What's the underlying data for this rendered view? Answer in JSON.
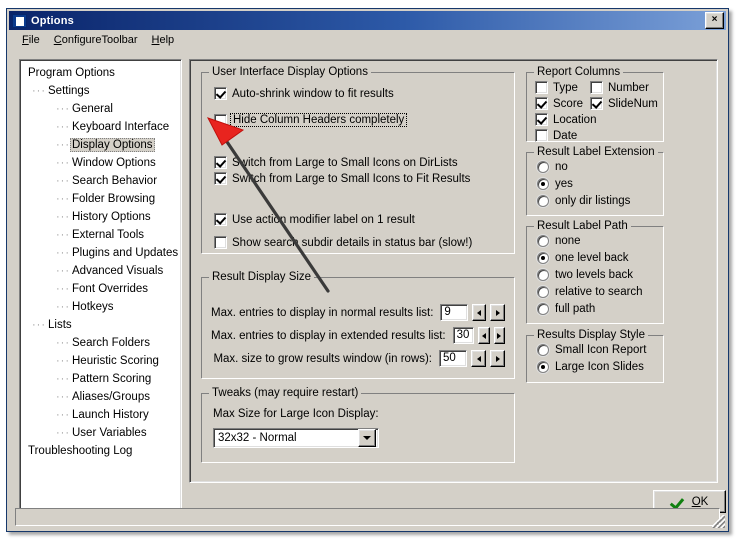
{
  "window": {
    "title": "Options",
    "icon": "options-list-icon",
    "close_label": "×"
  },
  "menu": {
    "items": [
      {
        "accel": "F",
        "rest": "ile"
      },
      {
        "accel": "C",
        "rest": "onfigureToolbar"
      },
      {
        "accel": "H",
        "rest": "elp"
      }
    ]
  },
  "tree": {
    "nodes": [
      {
        "label": "Program Options",
        "level": 0,
        "selected": false
      },
      {
        "label": "Settings",
        "level": 1,
        "selected": false
      },
      {
        "label": "General",
        "level": 2,
        "selected": false
      },
      {
        "label": "Keyboard Interface",
        "level": 2,
        "selected": false
      },
      {
        "label": "Display Options",
        "level": 2,
        "selected": true
      },
      {
        "label": "Window Options",
        "level": 2,
        "selected": false
      },
      {
        "label": "Search Behavior",
        "level": 2,
        "selected": false
      },
      {
        "label": "Folder Browsing",
        "level": 2,
        "selected": false
      },
      {
        "label": "History Options",
        "level": 2,
        "selected": false
      },
      {
        "label": "External Tools",
        "level": 2,
        "selected": false
      },
      {
        "label": "Plugins and Updates",
        "level": 2,
        "selected": false
      },
      {
        "label": "Advanced Visuals",
        "level": 2,
        "selected": false
      },
      {
        "label": "Font Overrides",
        "level": 2,
        "selected": false
      },
      {
        "label": "Hotkeys",
        "level": 2,
        "selected": false
      },
      {
        "label": "Lists",
        "level": 1,
        "selected": false
      },
      {
        "label": "Search Folders",
        "level": 2,
        "selected": false
      },
      {
        "label": "Heuristic Scoring",
        "level": 2,
        "selected": false
      },
      {
        "label": "Pattern Scoring",
        "level": 2,
        "selected": false
      },
      {
        "label": "Aliases/Groups",
        "level": 2,
        "selected": false
      },
      {
        "label": "Launch History",
        "level": 2,
        "selected": false
      },
      {
        "label": "User Variables",
        "level": 2,
        "selected": false
      },
      {
        "label": "Troubleshooting Log",
        "level": 0,
        "selected": false
      }
    ]
  },
  "ui_display": {
    "title": "User Interface Display Options",
    "checkboxes": [
      {
        "label": "Auto-shrink window to fit results",
        "checked": true,
        "focused": false
      },
      {
        "label": "Hide Column Headers completely",
        "checked": false,
        "focused": true
      },
      {
        "label": "Switch from Large to Small Icons on DirLists",
        "checked": true,
        "focused": false
      },
      {
        "label": "Switch from Large to Small Icons to Fit Results",
        "checked": true,
        "focused": false
      },
      {
        "label": "Use action modifier label on 1 result",
        "checked": true,
        "focused": false
      },
      {
        "label": "Show search subdir details in status bar (slow!)",
        "checked": false,
        "focused": false
      }
    ]
  },
  "result_display_size": {
    "title": "Result Display Size",
    "fields": [
      {
        "label": "Max. entries to display in normal results list:",
        "value": "9"
      },
      {
        "label": "Max. entries to display in extended results list:",
        "value": "30"
      },
      {
        "label": "Max. size to grow results window (in rows):",
        "value": "50"
      }
    ],
    "spin_down_icon": "triangle-left-icon",
    "spin_up_icon": "triangle-right-icon"
  },
  "tweaks": {
    "title": "Tweaks (may require restart)",
    "label": "Max Size for Large Icon Display:",
    "value": "32x32 - Normal",
    "dropdown_icon": "chevron-down-icon"
  },
  "report_columns": {
    "title": "Report Columns",
    "items": [
      {
        "label": "Type",
        "checked": false
      },
      {
        "label": "Number",
        "checked": false
      },
      {
        "label": "Score",
        "checked": true
      },
      {
        "label": "SlideNum",
        "checked": true
      },
      {
        "label": "Location",
        "checked": true
      },
      {
        "label": "Date",
        "checked": false
      }
    ]
  },
  "result_label_extension": {
    "title": "Result Label Extension",
    "options": [
      {
        "label": "no",
        "selected": false
      },
      {
        "label": "yes",
        "selected": true
      },
      {
        "label": "only dir listings",
        "selected": false
      }
    ]
  },
  "result_label_path": {
    "title": "Result Label Path",
    "options": [
      {
        "label": "none",
        "selected": false
      },
      {
        "label": "one level back",
        "selected": true
      },
      {
        "label": "two levels back",
        "selected": false
      },
      {
        "label": "relative to search",
        "selected": false
      },
      {
        "label": "full path",
        "selected": false
      }
    ]
  },
  "results_display_style": {
    "title": "Results Display Style",
    "options": [
      {
        "label": "Small Icon Report",
        "selected": false
      },
      {
        "label": "Large Icon Slides",
        "selected": true
      }
    ]
  },
  "footer": {
    "ok_accel": "O",
    "ok_rest": "K",
    "ok_icon": "green-check-icon",
    "resize_grip_icon": "resize-grip-icon"
  },
  "annotation": {
    "arrow_color": "#e8241f",
    "arrow_line_color": "#3a3a3a",
    "points_at": "Hide Column Headers completely"
  },
  "colors": {
    "face": "#d4d0c8",
    "title_start": "#0a246a",
    "title_end": "#7ba0d8",
    "selection": "#d4d0c8"
  }
}
